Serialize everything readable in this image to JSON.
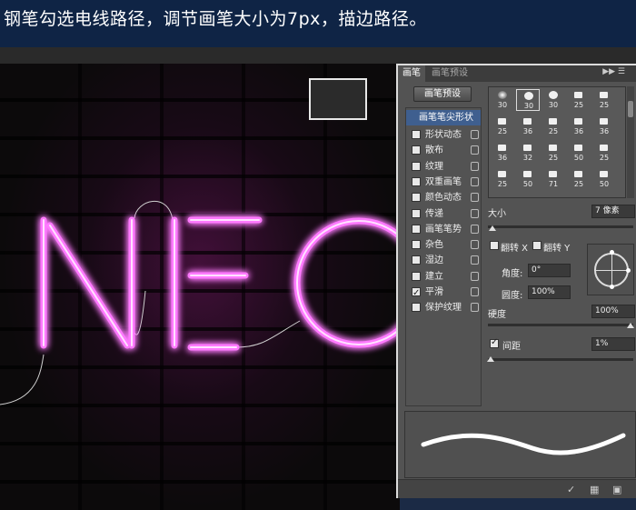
{
  "caption": {
    "text": "钢笔勾选电线路径，调节画笔大小为7px，描边路径。"
  },
  "canvas": {
    "neon_text": "NEO",
    "neon_color": "#ff66ff",
    "glow_color": "#c020c0",
    "wall_color": "#1a1617"
  },
  "panel": {
    "tabs": [
      {
        "label": "画笔",
        "active": true
      },
      {
        "label": "画笔预设",
        "active": false
      }
    ],
    "menu_icon": "panel-menu-icon",
    "preset_button": "画笔预设",
    "list_header": "画笔笔尖形状",
    "list_items": [
      {
        "label": "形状动态",
        "checked": false
      },
      {
        "label": "散布",
        "checked": false
      },
      {
        "label": "纹理",
        "checked": false
      },
      {
        "label": "双重画笔",
        "checked": false
      },
      {
        "label": "颜色动态",
        "checked": false
      },
      {
        "label": "传递",
        "checked": false
      },
      {
        "label": "画笔笔势",
        "checked": false
      },
      {
        "label": "杂色",
        "checked": false
      },
      {
        "label": "湿边",
        "checked": false
      },
      {
        "label": "建立",
        "checked": false
      },
      {
        "label": "平滑",
        "checked": true
      },
      {
        "label": "保护纹理",
        "checked": false
      }
    ],
    "brush_tips": [
      {
        "size": "30",
        "kind": "soft",
        "selected": false
      },
      {
        "size": "30",
        "kind": "hard",
        "selected": true
      },
      {
        "size": "30",
        "kind": "hard",
        "selected": false
      },
      {
        "size": "25",
        "kind": "sq",
        "selected": false
      },
      {
        "size": "25",
        "kind": "sq",
        "selected": false
      },
      {
        "size": "25",
        "kind": "sq",
        "selected": false
      },
      {
        "size": "36",
        "kind": "sq",
        "selected": false
      },
      {
        "size": "25",
        "kind": "sq",
        "selected": false
      },
      {
        "size": "36",
        "kind": "sq",
        "selected": false
      },
      {
        "size": "36",
        "kind": "sq",
        "selected": false
      },
      {
        "size": "36",
        "kind": "sq",
        "selected": false
      },
      {
        "size": "32",
        "kind": "sq",
        "selected": false
      },
      {
        "size": "25",
        "kind": "sq",
        "selected": false
      },
      {
        "size": "50",
        "kind": "sq",
        "selected": false
      },
      {
        "size": "25",
        "kind": "sq",
        "selected": false
      },
      {
        "size": "25",
        "kind": "sq",
        "selected": false
      },
      {
        "size": "50",
        "kind": "sq",
        "selected": false
      },
      {
        "size": "71",
        "kind": "sq",
        "selected": false
      },
      {
        "size": "25",
        "kind": "sq",
        "selected": false
      },
      {
        "size": "50",
        "kind": "sq",
        "selected": false
      }
    ],
    "size_label": "大小",
    "size_value": "7 像素",
    "flip_x": "翻转 X",
    "flip_y": "翻转 Y",
    "angle_label": "角度:",
    "angle_value": "0°",
    "roundness_label": "圆度:",
    "roundness_value": "100%",
    "hardness_label": "硬度",
    "hardness_value": "100%",
    "spacing_label": "间距",
    "spacing_checked": true,
    "spacing_value": "1%"
  }
}
